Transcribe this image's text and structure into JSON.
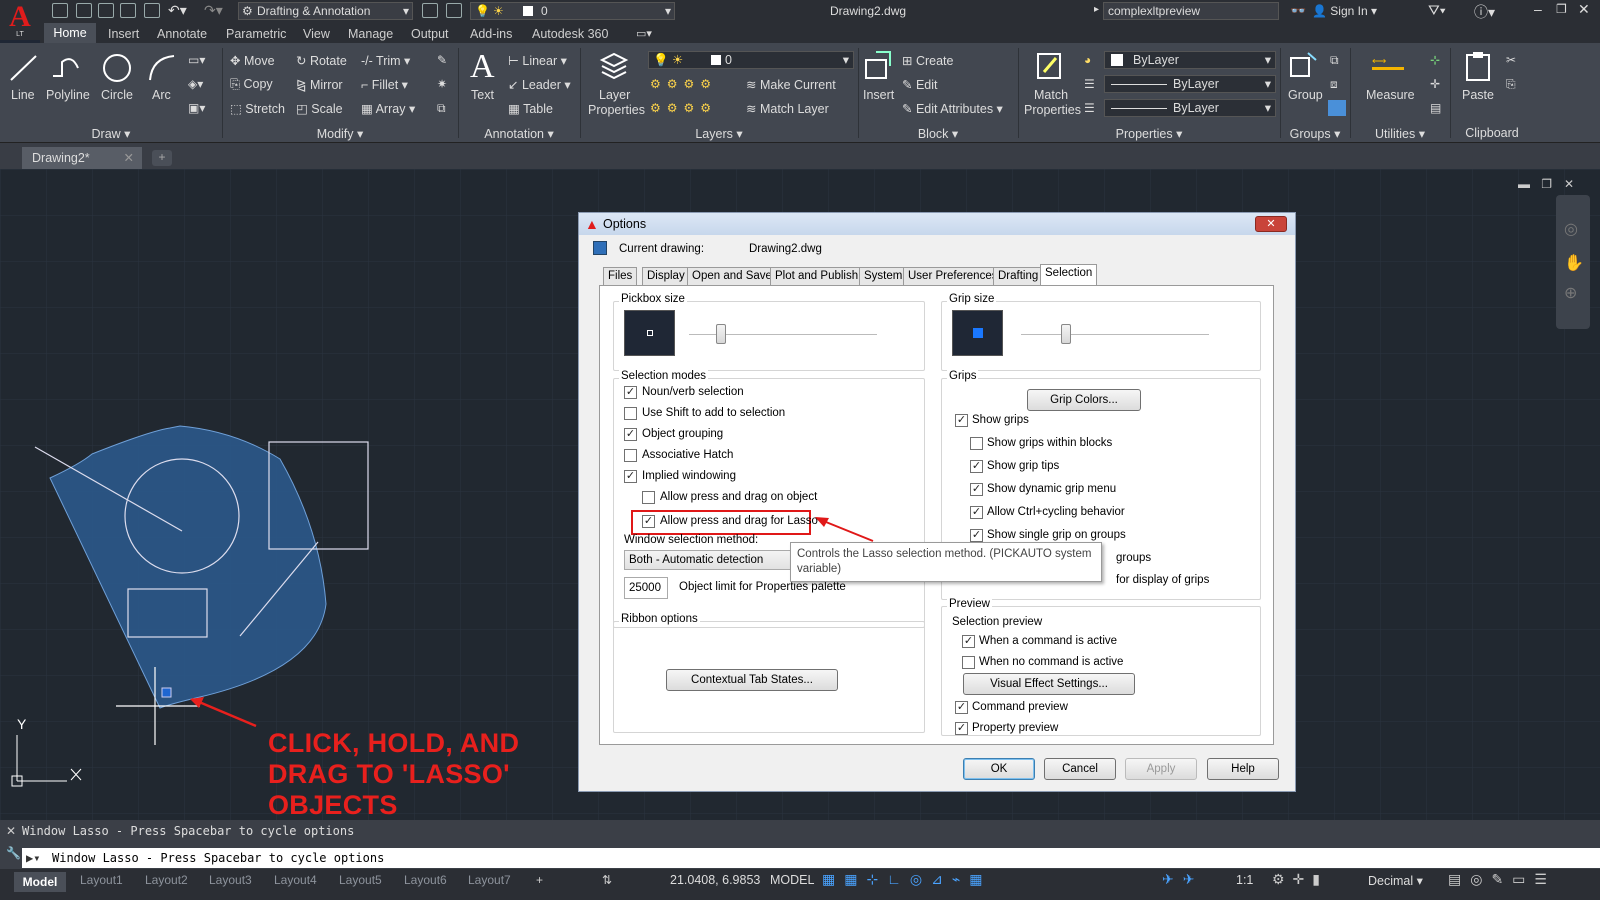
{
  "app": {
    "logo_letter": "A",
    "logo_sub": "LT"
  },
  "titlebar": {
    "workspace": "Drafting & Annotation",
    "layer": "0",
    "document": "Drawing2.dwg",
    "search": "complexltpreview",
    "sign_in": "Sign In"
  },
  "menu_tabs": [
    "Home",
    "Insert",
    "Annotate",
    "Parametric",
    "View",
    "Manage",
    "Output",
    "Add-ins",
    "Autodesk 360"
  ],
  "ribbon": {
    "draw": {
      "line": "Line",
      "polyline": "Polyline",
      "circle": "Circle",
      "arc": "Arc",
      "panel": "Draw"
    },
    "modify": {
      "move": "Move",
      "rotate": "Rotate",
      "trim": "Trim",
      "copy": "Copy",
      "mirror": "Mirror",
      "fillet": "Fillet",
      "stretch": "Stretch",
      "scale": "Scale",
      "array": "Array",
      "panel": "Modify"
    },
    "annotation": {
      "text": "Text",
      "linear": "Linear",
      "leader": "Leader",
      "table": "Table",
      "panel": "Annotation"
    },
    "layers": {
      "layer_properties_1": "Layer",
      "layer_properties_2": "Properties",
      "layer_value": "0",
      "make_current": "Make Current",
      "match_layer": "Match Layer",
      "panel": "Layers"
    },
    "block": {
      "insert": "Insert",
      "create": "Create",
      "edit": "Edit",
      "edit_attributes": "Edit Attributes",
      "panel": "Block"
    },
    "properties": {
      "match_1": "Match",
      "match_2": "Properties",
      "color": "ByLayer",
      "linetype": "ByLayer",
      "lineweight": "ByLayer",
      "panel": "Properties"
    },
    "groups": {
      "group": "Group",
      "panel": "Groups"
    },
    "utilities": {
      "measure": "Measure",
      "panel": "Utilities"
    },
    "clipboard": {
      "paste": "Paste",
      "panel": "Clipboard"
    }
  },
  "doc_tab": "Drawing2*",
  "dialog": {
    "title": "Options",
    "current_drawing_label": "Current drawing:",
    "current_drawing_value": "Drawing2.dwg",
    "tabs": [
      "Files",
      "Display",
      "Open and Save",
      "Plot and Publish",
      "System",
      "User Preferences",
      "Drafting",
      "Selection"
    ],
    "pickbox_label": "Pickbox size",
    "grip_size_label": "Grip size",
    "selection_modes_label": "Selection modes",
    "selection_modes": [
      {
        "label": "Noun/verb selection",
        "checked": "✓"
      },
      {
        "label": "Use Shift to add to selection",
        "checked": ""
      },
      {
        "label": "Object grouping",
        "checked": "✓"
      },
      {
        "label": "Associative Hatch",
        "checked": ""
      },
      {
        "label": "Implied windowing",
        "checked": "✓"
      },
      {
        "label": "Allow press and drag on object",
        "checked": ""
      },
      {
        "label": "Allow press and drag for Lasso",
        "checked": "✓"
      }
    ],
    "window_method_label": "Window selection method:",
    "window_method_value": "Both - Automatic detection",
    "object_limit_value": "25000",
    "object_limit_label": "Object limit for Properties palette",
    "ribbon_options_label": "Ribbon options",
    "contextual_button": "Contextual Tab States...",
    "grips_label": "Grips",
    "grip_colors_button": "Grip Colors...",
    "grips": [
      {
        "label": "Show grips",
        "checked": "✓"
      },
      {
        "label": "Show grips within blocks",
        "checked": ""
      },
      {
        "label": "Show grip tips",
        "checked": "✓"
      },
      {
        "label": "Show dynamic grip menu",
        "checked": "✓"
      },
      {
        "label": "Allow Ctrl+cycling behavior",
        "checked": "✓"
      },
      {
        "label": "Show single grip on groups",
        "checked": "✓"
      }
    ],
    "grips_partial_1": "groups",
    "grips_partial_2": "for display of grips",
    "preview_label": "Preview",
    "selection_preview_label": "Selection preview",
    "preview": [
      {
        "label": "When a command is active",
        "checked": "✓"
      },
      {
        "label": "When no command is active",
        "checked": ""
      }
    ],
    "visual_effect_button": "Visual Effect Settings...",
    "preview2": [
      {
        "label": "Command preview",
        "checked": "✓"
      },
      {
        "label": "Property preview",
        "checked": "✓"
      }
    ],
    "ok": "OK",
    "cancel": "Cancel",
    "apply": "Apply",
    "help": "Help",
    "tooltip": "Controls the Lasso selection method. (PICKAUTO system variable)"
  },
  "canvas": {
    "annotation": [
      "CLICK, HOLD, AND",
      "DRAG TO 'LASSO'",
      "OBJECTS"
    ],
    "ucs_y": "Y"
  },
  "command": {
    "history": "Window Lasso - Press Spacebar to cycle options",
    "input": "Window Lasso - Press Spacebar to cycle options"
  },
  "status": {
    "layouts": [
      "Model",
      "Layout1",
      "Layout2",
      "Layout3",
      "Layout4",
      "Layout5",
      "Layout6",
      "Layout7"
    ],
    "coords": "21.0408, 6.9853",
    "model": "MODEL",
    "scale": "1:1",
    "units": "Decimal"
  }
}
